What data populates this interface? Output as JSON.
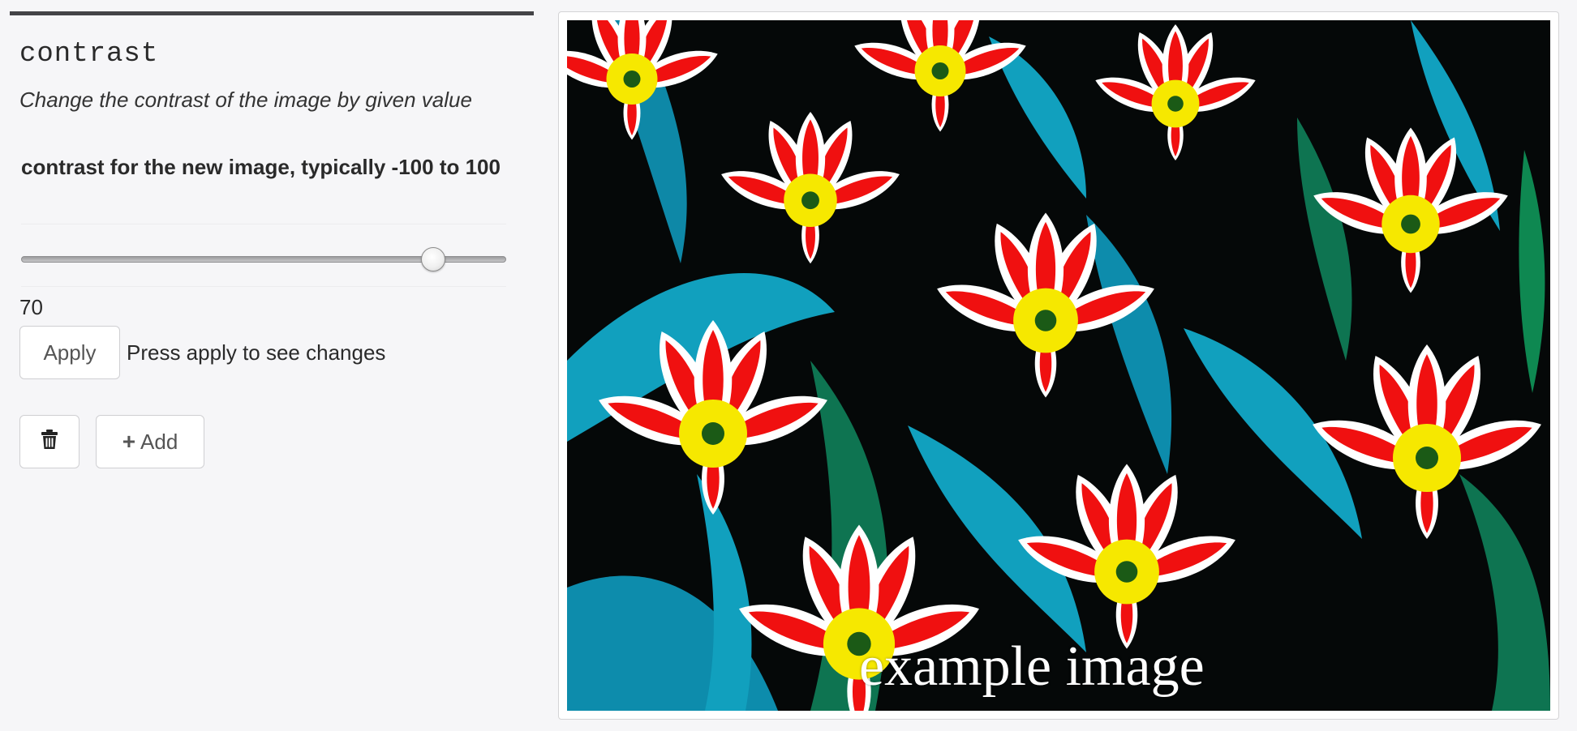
{
  "function": {
    "name": "contrast",
    "description": "Change the contrast of the image by given value"
  },
  "parameter": {
    "label": "contrast for the new image, typically -100 to 100",
    "min": -100,
    "max": 100,
    "value": 70,
    "value_text": "70"
  },
  "actions": {
    "apply_label": "Apply",
    "apply_hint": "Press apply to see changes",
    "delete_icon": "trash-icon",
    "add_icon": "plus-icon",
    "add_label": "Add"
  },
  "image": {
    "caption": "example image"
  },
  "colors": {
    "background": "#f6f6f8",
    "rule": "#444447",
    "petal_red": "#f01010",
    "petal_yellow": "#f6e800",
    "leaf_cyan": "#12a9c8",
    "leaf_green": "#0f7a55"
  }
}
